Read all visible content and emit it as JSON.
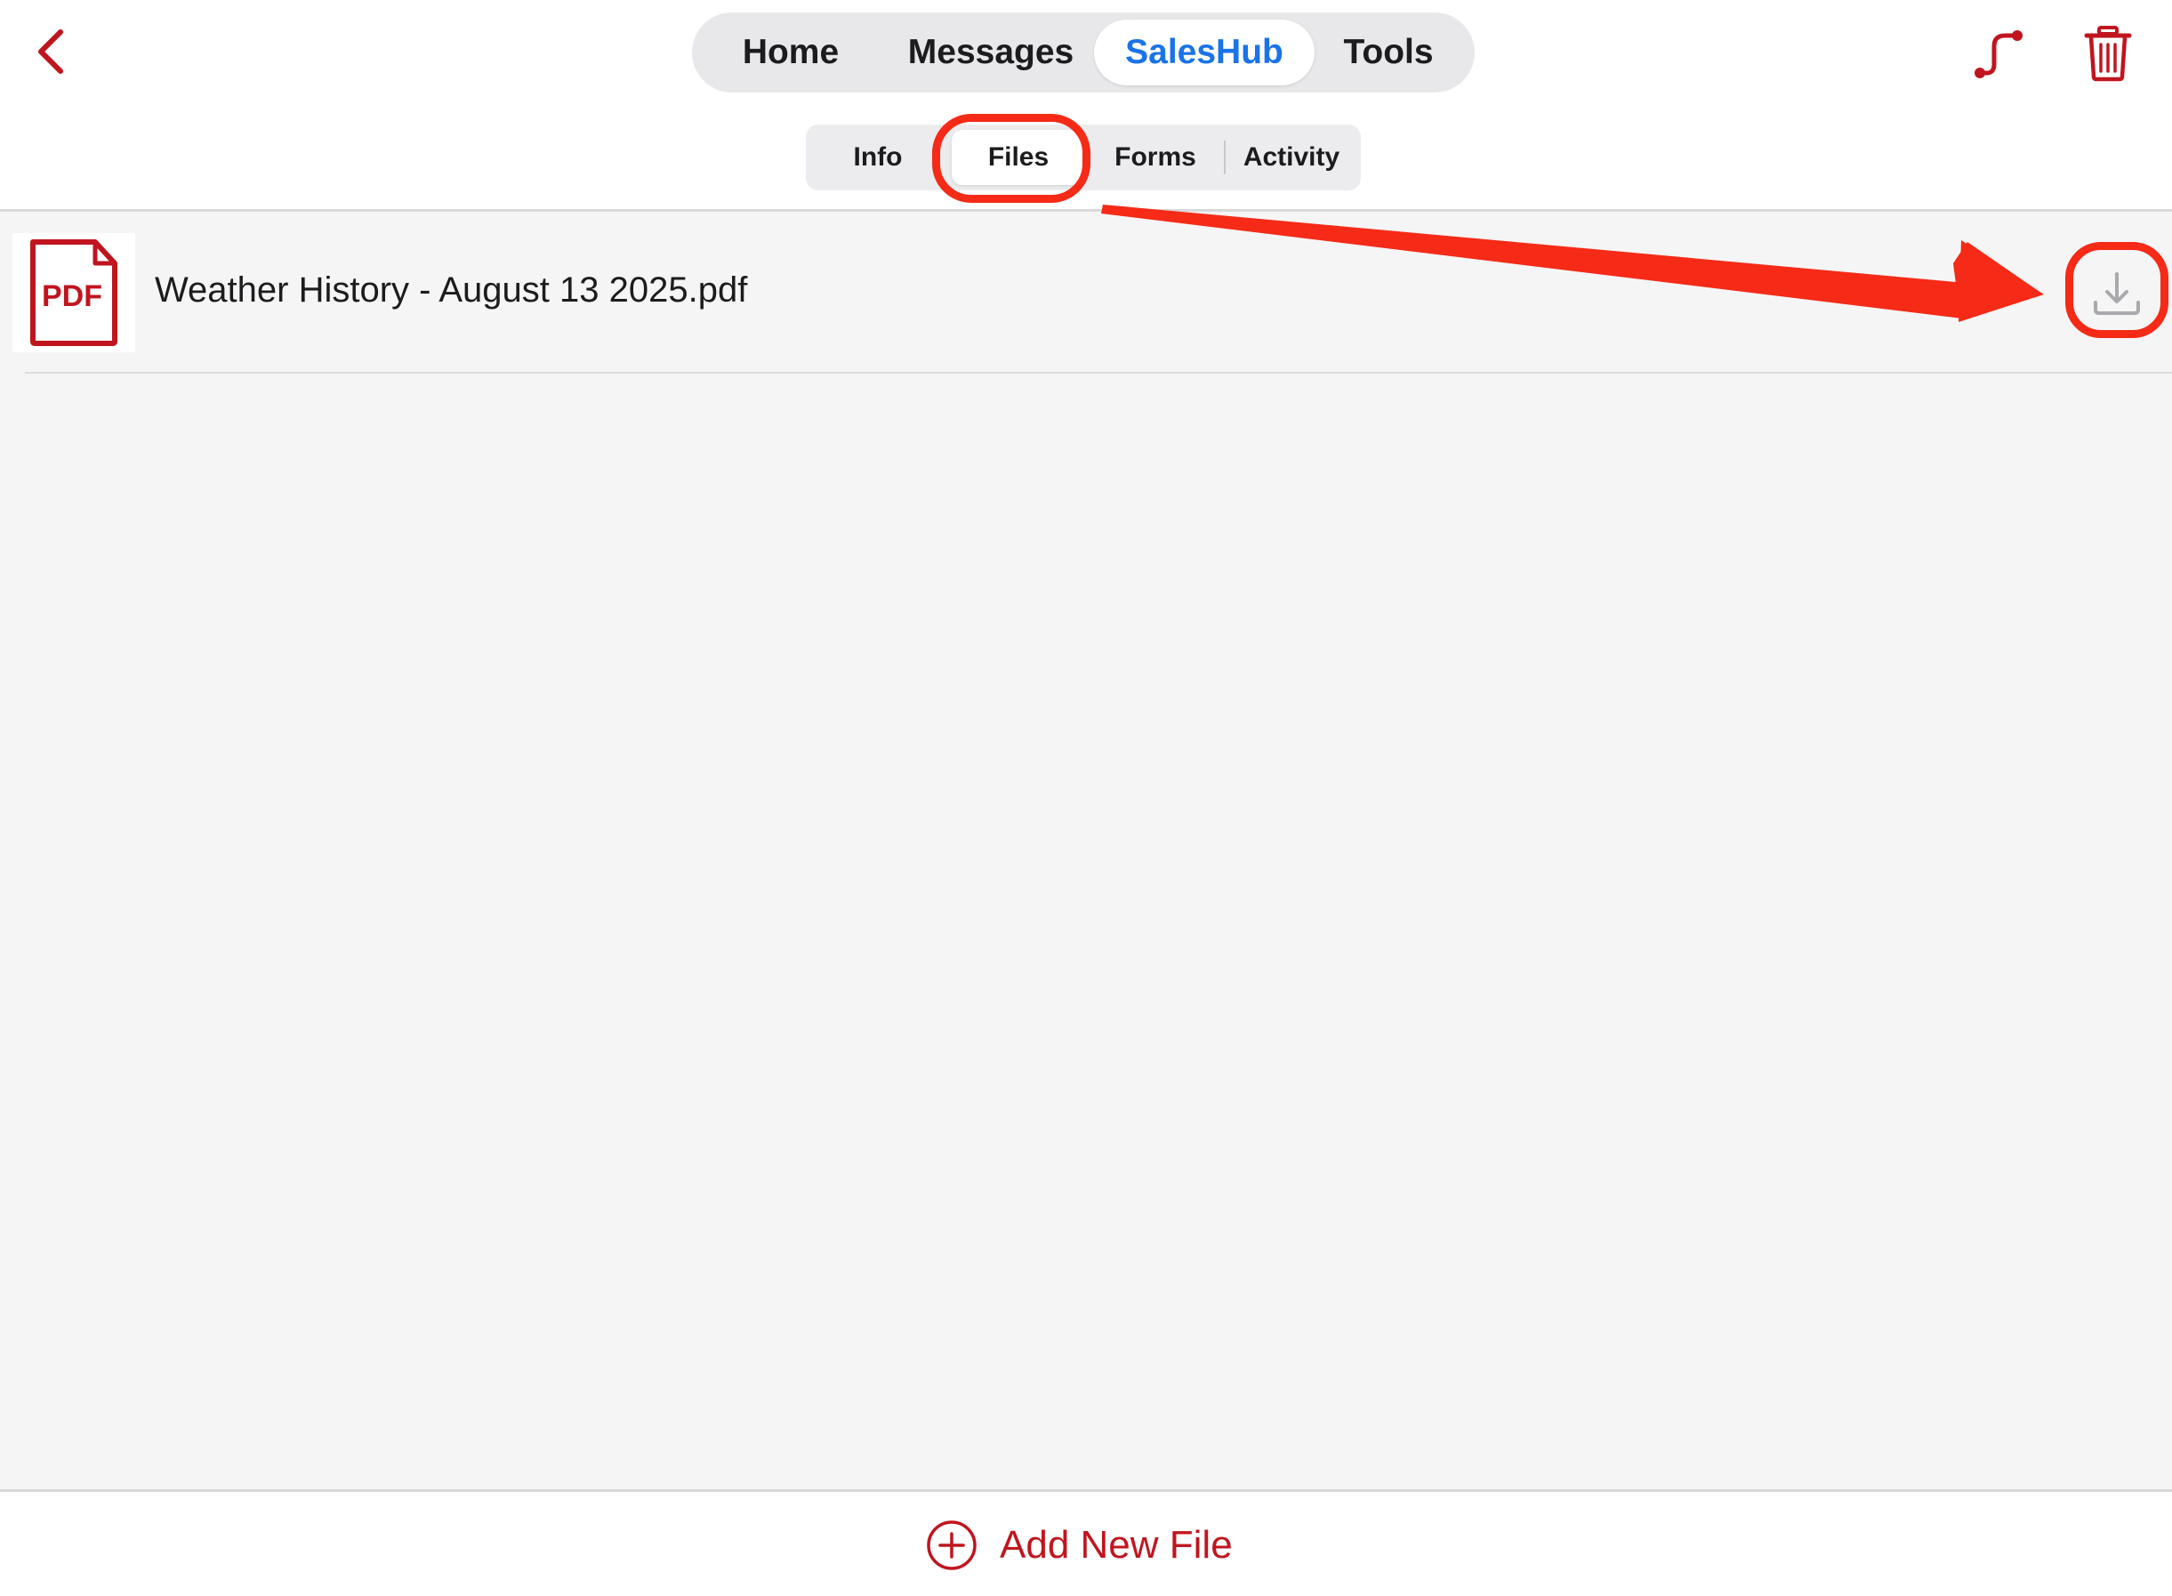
{
  "header": {
    "main_tabs": [
      {
        "label": "Home",
        "active": false
      },
      {
        "label": "Messages",
        "active": false
      },
      {
        "label": "SalesHub",
        "active": true
      },
      {
        "label": "Tools",
        "active": false
      }
    ],
    "sub_tabs": [
      {
        "label": "Info",
        "active": false
      },
      {
        "label": "Files",
        "active": true
      },
      {
        "label": "Forms",
        "active": false
      },
      {
        "label": "Activity",
        "active": false
      }
    ],
    "icons": {
      "back": "chevron-left-icon",
      "route": "route-icon",
      "trash": "trash-icon"
    }
  },
  "files": [
    {
      "name": "Weather History - August 13 2025.pdf",
      "thumb_label": "PDF",
      "icon": "pdf-file-icon",
      "action_icon": "download-icon"
    }
  ],
  "footer": {
    "add_label": "Add New File",
    "add_icon": "plus-circle-icon"
  },
  "colors": {
    "brand_red": "#c0151f",
    "active_blue": "#1a73e8",
    "annotation_red": "#f52a17",
    "content_bg": "#f5f5f6"
  }
}
